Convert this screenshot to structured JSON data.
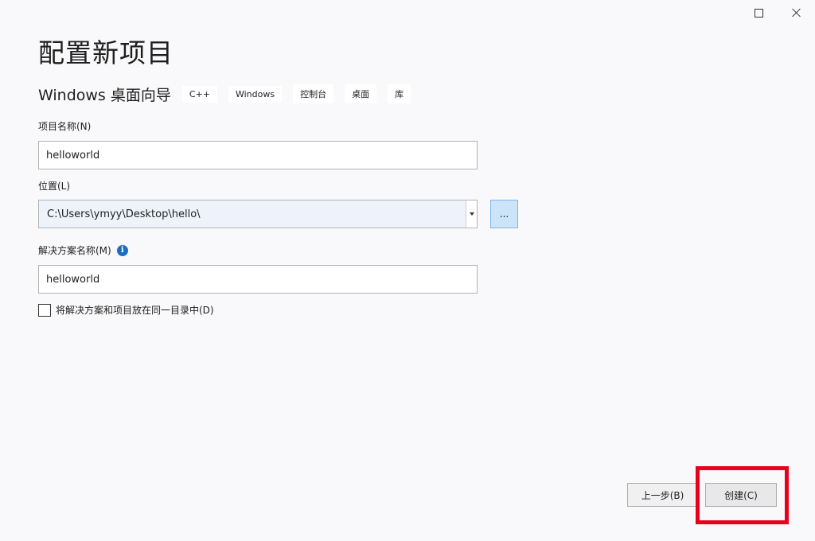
{
  "window": {
    "maximize_icon": "maximize-icon",
    "close_icon": "close-icon"
  },
  "header": {
    "title": "配置新项目",
    "template_name": "Windows 桌面向导",
    "tags": [
      "C++",
      "Windows",
      "控制台",
      "桌面",
      "库"
    ]
  },
  "form": {
    "project_name": {
      "label": "项目名称(N)",
      "value": "helloworld"
    },
    "location": {
      "label": "位置(L)",
      "value": "C:\\Users\\ymyy\\Desktop\\hello\\",
      "browse_label": "..."
    },
    "solution_name": {
      "label": "解决方案名称(M)",
      "value": "helloworld",
      "info_glyph": "i"
    },
    "same_dir": {
      "label": "将解决方案和项目放在同一目录中(D)",
      "checked": false
    }
  },
  "footer": {
    "back_label": "上一步(B)",
    "create_label": "创建(C)"
  },
  "colors": {
    "highlight": "#e8001c",
    "accent": "#1b6ec2"
  }
}
